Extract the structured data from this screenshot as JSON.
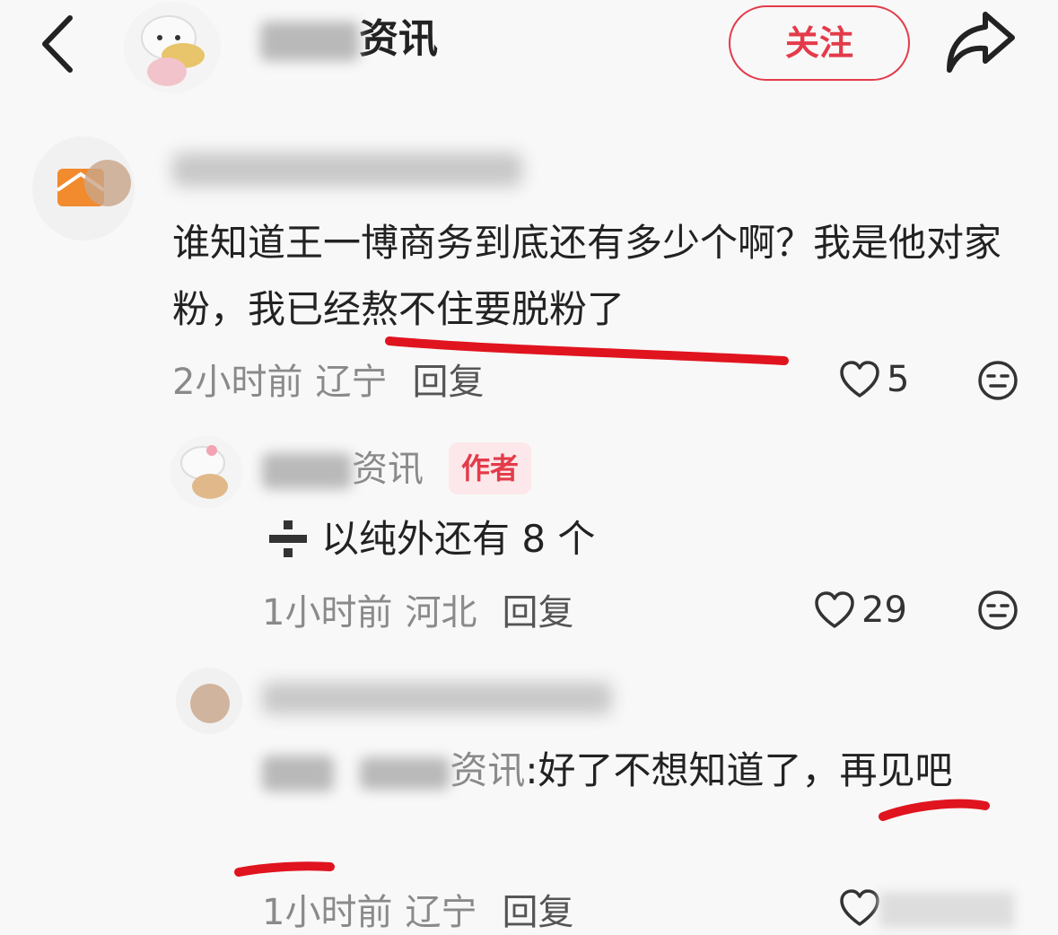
{
  "header": {
    "title_suffix": "资讯",
    "follow_label": "关注"
  },
  "comments": [
    {
      "text": "谁知道王一博商务到底还有多少个啊？我是他对家粉，我已经熬不住要脱粉了",
      "time": "2小时前",
      "location": "辽宁",
      "reply_label": "回复",
      "likes": "5"
    },
    {
      "author_suffix": "资讯",
      "author_tag": "作者",
      "text": "以纯外还有 8 个",
      "time": "1小时前",
      "location": "河北",
      "reply_label": "回复",
      "likes": "29"
    },
    {
      "text_prefix": "资讯",
      "text_colon": ":",
      "text": "好了不想知道了，再见吧",
      "time": "1小时前",
      "location": "辽宁",
      "reply_label": "回复"
    }
  ],
  "icons": {
    "back": "back-arrow-icon",
    "share": "share-icon",
    "like": "heart-icon",
    "dislike": "meh-face-icon",
    "plus_minus": "divide-icon"
  },
  "colors": {
    "accent": "#e33b4a",
    "annotation": "#e0141e",
    "muted_text": "#8a8a8a"
  }
}
